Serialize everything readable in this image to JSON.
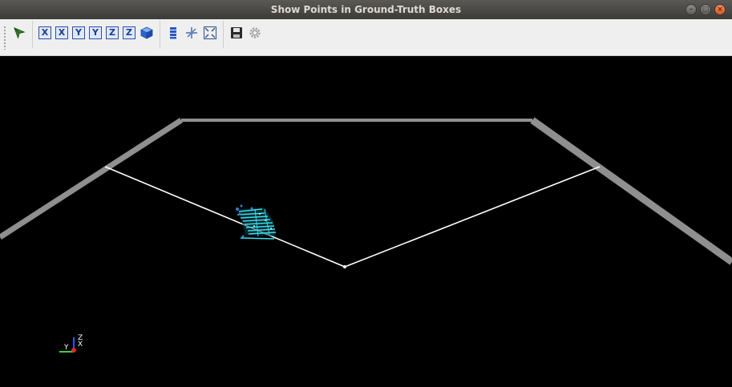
{
  "window": {
    "title": "Show Points in Ground-Truth Boxes",
    "controls": {
      "minimize": "–",
      "maximize": "▢",
      "close": "×"
    }
  },
  "toolbar": {
    "view_buttons": [
      {
        "label": "X",
        "name": "view-x-positive-button"
      },
      {
        "label": "X",
        "name": "view-x-negative-button"
      },
      {
        "label": "Y",
        "name": "view-y-positive-button"
      },
      {
        "label": "Y",
        "name": "view-y-negative-button"
      },
      {
        "label": "Z",
        "name": "view-z-positive-button"
      },
      {
        "label": "Z",
        "name": "view-z-negative-button"
      }
    ],
    "icons": [
      "select-arrow-icon",
      "cube-isometric-icon",
      "layers-icon",
      "move-axes-icon",
      "fit-view-icon",
      "save-icon",
      "settings-gear-icon"
    ]
  },
  "viewport": {
    "axes_labels": {
      "x": "X",
      "y": "Y",
      "z": "Z"
    },
    "colors": {
      "background": "#000000",
      "road_edges": "#8f8f8f",
      "fov_lines": "#ffffff",
      "points": "#35e0ee",
      "points_dark": "#3c7ac8"
    }
  }
}
